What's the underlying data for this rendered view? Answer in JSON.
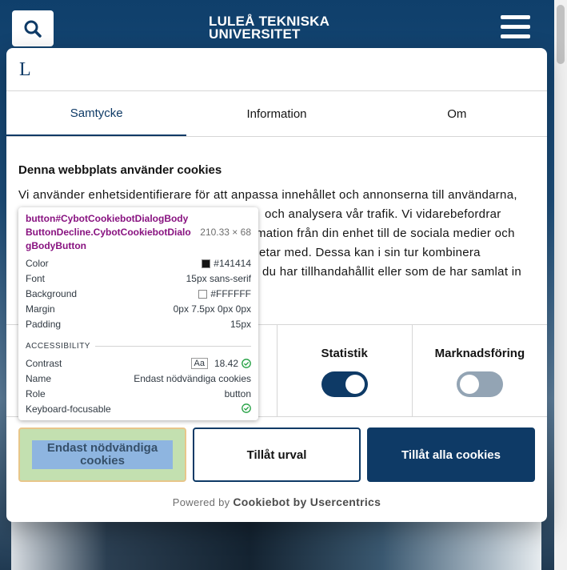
{
  "site": {
    "logo_line1": "LULEÅ TEKNISKA",
    "logo_line2": "UNIVERSITET"
  },
  "dialog": {
    "logo_letter": "L",
    "tabs": [
      {
        "label": "Samtycke",
        "active": true
      },
      {
        "label": "Information",
        "active": false
      },
      {
        "label": "Om",
        "active": false
      }
    ],
    "heading": "Denna webbplats använder cookies",
    "text_lines": [
      "Vi använder enhetsidentifierare för att anpassa innehållet och annonserna till användarna,",
      "och analysera vår trafik. Vi vidarebefordrar",
      "mation från din enhet till de sociala medier och",
      "etar med. Dessa kan i sin tur kombinera",
      "du har tillhandahållit eller som de har samlat in"
    ],
    "categories": [
      {
        "label": "",
        "state": "hidden"
      },
      {
        "label": "",
        "state": "hidden"
      },
      {
        "label": "Statistik",
        "state": "on"
      },
      {
        "label": "Marknadsföring",
        "state": "off"
      }
    ],
    "buttons": {
      "decline": "Endast nödvändiga cookies",
      "select": "Tillåt urval",
      "all": "Tillåt alla cookies"
    },
    "powered_prefix": "Powered by",
    "powered_brand": "Cookiebot by Usercentrics"
  },
  "devtools": {
    "selector_tag": "button",
    "selector_rest": "#CybotCookiebotDialogBodyButtonDecline.CybotCookiebotDialogBodyButton",
    "dimensions": "210.33 × 68",
    "rows": [
      {
        "label": "Color",
        "value": "#141414",
        "swatch": "#141414"
      },
      {
        "label": "Font",
        "value": "15px sans-serif"
      },
      {
        "label": "Background",
        "value": "#FFFFFF",
        "swatch": "#FFFFFF"
      },
      {
        "label": "Margin",
        "value": "0px 7.5px 0px 0px"
      },
      {
        "label": "Padding",
        "value": "15px"
      }
    ],
    "accessibility_heading": "ACCESSIBILITY",
    "acc_rows": [
      {
        "label": "Contrast",
        "value": "18.42",
        "badge": "Aa",
        "check": true
      },
      {
        "label": "Name",
        "value": "Endast nödvändiga cookies"
      },
      {
        "label": "Role",
        "value": "button"
      },
      {
        "label": "Keyboard-focusable",
        "value": "",
        "check": true
      }
    ]
  },
  "colors": {
    "brand": "#0e3a66",
    "check": "#1e9e3e"
  }
}
